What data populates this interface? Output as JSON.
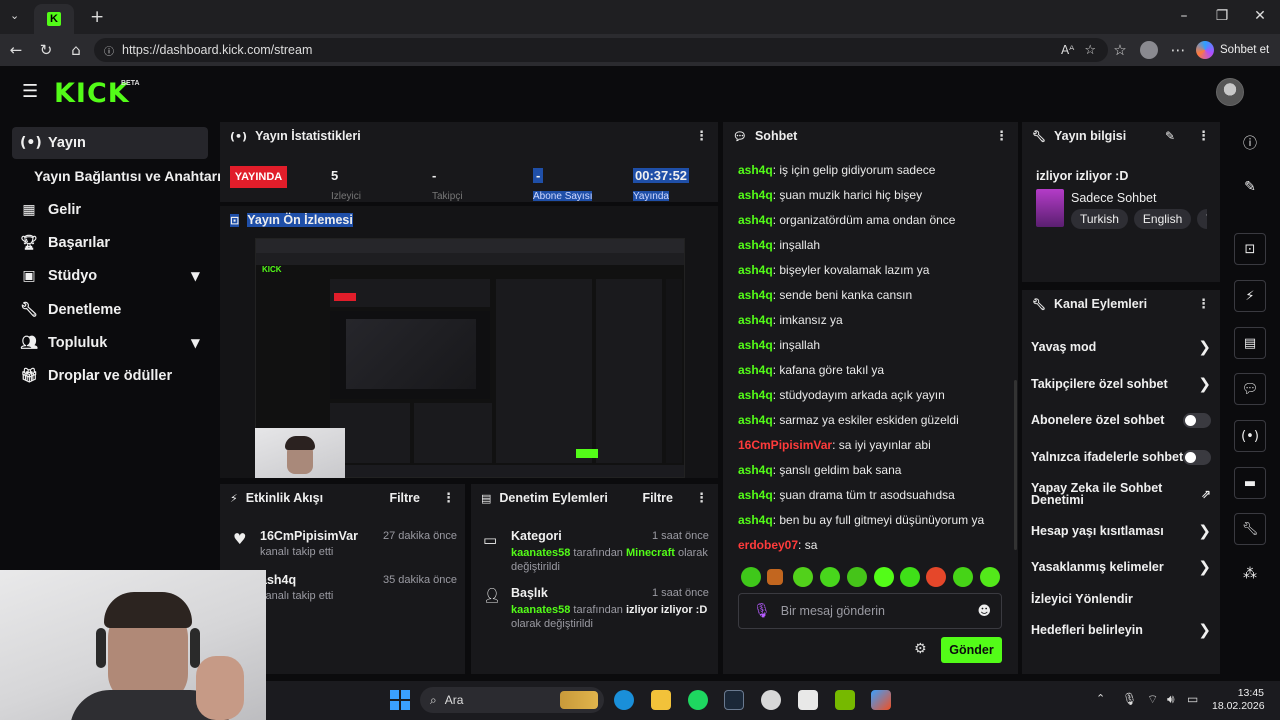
{
  "browser": {
    "url": "https://dashboard.kick.com/stream",
    "chat_button": "Sohbet et"
  },
  "app": {
    "logo": "KICK",
    "beta": "BETA"
  },
  "sidebar": {
    "items": [
      {
        "label": "Yayın",
        "icon": "broadcast-icon"
      },
      {
        "label": "Yayın Bağlantısı ve Anahtarı"
      },
      {
        "label": "Gelir",
        "icon": "chart-icon"
      },
      {
        "label": "Başarılar",
        "icon": "trophy-icon"
      },
      {
        "label": "Stüdyo",
        "icon": "studio-icon"
      },
      {
        "label": "Denetleme",
        "icon": "wrench-icon"
      },
      {
        "label": "Topluluk",
        "icon": "people-icon"
      },
      {
        "label": "Droplar ve ödüller",
        "icon": "gift-icon"
      }
    ]
  },
  "stats": {
    "title": "Yayın İstatistikleri",
    "live": "YAYINDA",
    "viewers": "5",
    "viewers_label": "İzleyici",
    "followers": "-",
    "followers_label": "Takipçi",
    "subs": "-",
    "subs_label": "Abone Sayısı",
    "duration": "00:37:52",
    "duration_label": "Yayında"
  },
  "preview": {
    "title": "Yayın Ön İzlemesi"
  },
  "activity": {
    "title": "Etkinlik Akışı",
    "filter": "Filtre",
    "items": [
      {
        "name": "16CmPipisimVar",
        "action": "kanalı takip etti",
        "time": "27 dakika önce"
      },
      {
        "name": "ash4q",
        "action": "kanalı takip etti",
        "time": "35 dakika önce"
      }
    ]
  },
  "moderation": {
    "title": "Denetim Eylemleri",
    "filter": "Filtre",
    "items": [
      {
        "title": "Kategori",
        "time": "1 saat önce",
        "user": "kaanates58",
        "mid": "tarafından",
        "value": "Minecraft",
        "tail": "olarak değiştirildi"
      },
      {
        "title": "Başlık",
        "time": "1 saat önce",
        "user": "kaanates58",
        "mid": "tarafından",
        "value": "izliyor izliyor :D",
        "tail": "olarak değiştirildi"
      }
    ]
  },
  "chat": {
    "title": "Sohbet",
    "messages": [
      {
        "user": "ash4q",
        "text": "iş için gelip gidiyorum sadece",
        "color": "#53fc18"
      },
      {
        "user": "ash4q",
        "text": "şuan muzik harici hiç bişey",
        "color": "#53fc18"
      },
      {
        "user": "ash4q",
        "text": "organizatördüm ama ondan önce",
        "color": "#53fc18"
      },
      {
        "user": "ash4q",
        "text": "inşallah",
        "color": "#53fc18"
      },
      {
        "user": "ash4q",
        "text": "bişeyler kovalamak lazım ya",
        "color": "#53fc18"
      },
      {
        "user": "ash4q",
        "text": "sende beni kanka cansın",
        "color": "#53fc18"
      },
      {
        "user": "ash4q",
        "text": "imkansız ya",
        "color": "#53fc18"
      },
      {
        "user": "ash4q",
        "text": "inşallah",
        "color": "#53fc18"
      },
      {
        "user": "ash4q",
        "text": "kafana göre takıl ya",
        "color": "#53fc18"
      },
      {
        "user": "ash4q",
        "text": "stüdyodayım arkada açık yayın",
        "color": "#53fc18"
      },
      {
        "user": "ash4q",
        "text": "sarmaz ya eskiler eskiden güzeldi",
        "color": "#53fc18"
      },
      {
        "user": "16CmPipisimVar",
        "text": "sa iyi yayınlar abi",
        "color": "#ff3b3b"
      },
      {
        "user": "ash4q",
        "text": "şanslı geldim bak sana",
        "color": "#53fc18"
      },
      {
        "user": "ash4q",
        "text": "şuan drama tüm tr asodsuahıdsa",
        "color": "#53fc18"
      },
      {
        "user": "ash4q",
        "text": "ben bu ay full gitmeyi düşünüyorum ya",
        "color": "#53fc18"
      },
      {
        "user": "erdobey07",
        "text": "sa",
        "color": "#ff3b3b"
      }
    ],
    "input_placeholder": "Bir mesaj gönderin",
    "send": "Gönder"
  },
  "stream_info": {
    "title": "Yayın bilgisi",
    "stream_title": "izliyor izliyor :D",
    "category": "Sadece Sohbet",
    "tags": [
      "Turkish",
      "English",
      "T"
    ]
  },
  "channel_actions": {
    "title": "Kanal Eylemleri",
    "items": [
      {
        "label": "Yavaş mod",
        "control": "arrow"
      },
      {
        "label": "Takipçilere özel sohbet",
        "control": "arrow"
      },
      {
        "label": "Abonelere özel sohbet",
        "control": "toggle"
      },
      {
        "label": "Yalnızca ifadelerle sohbet",
        "control": "toggle"
      },
      {
        "label": "Yapay Zeka ile Sohbet Denetimi",
        "control": "external"
      },
      {
        "label": "Hesap yaşı kısıtlaması",
        "control": "arrow"
      },
      {
        "label": "Yasaklanmış kelimeler",
        "control": "arrow"
      },
      {
        "label": "İzleyici Yönlendir",
        "control": "none"
      },
      {
        "label": "Hedefleri belirleyin",
        "control": "arrow"
      }
    ]
  },
  "taskbar": {
    "search": "Ara",
    "time": "13:45",
    "date": "18.02.2026"
  }
}
